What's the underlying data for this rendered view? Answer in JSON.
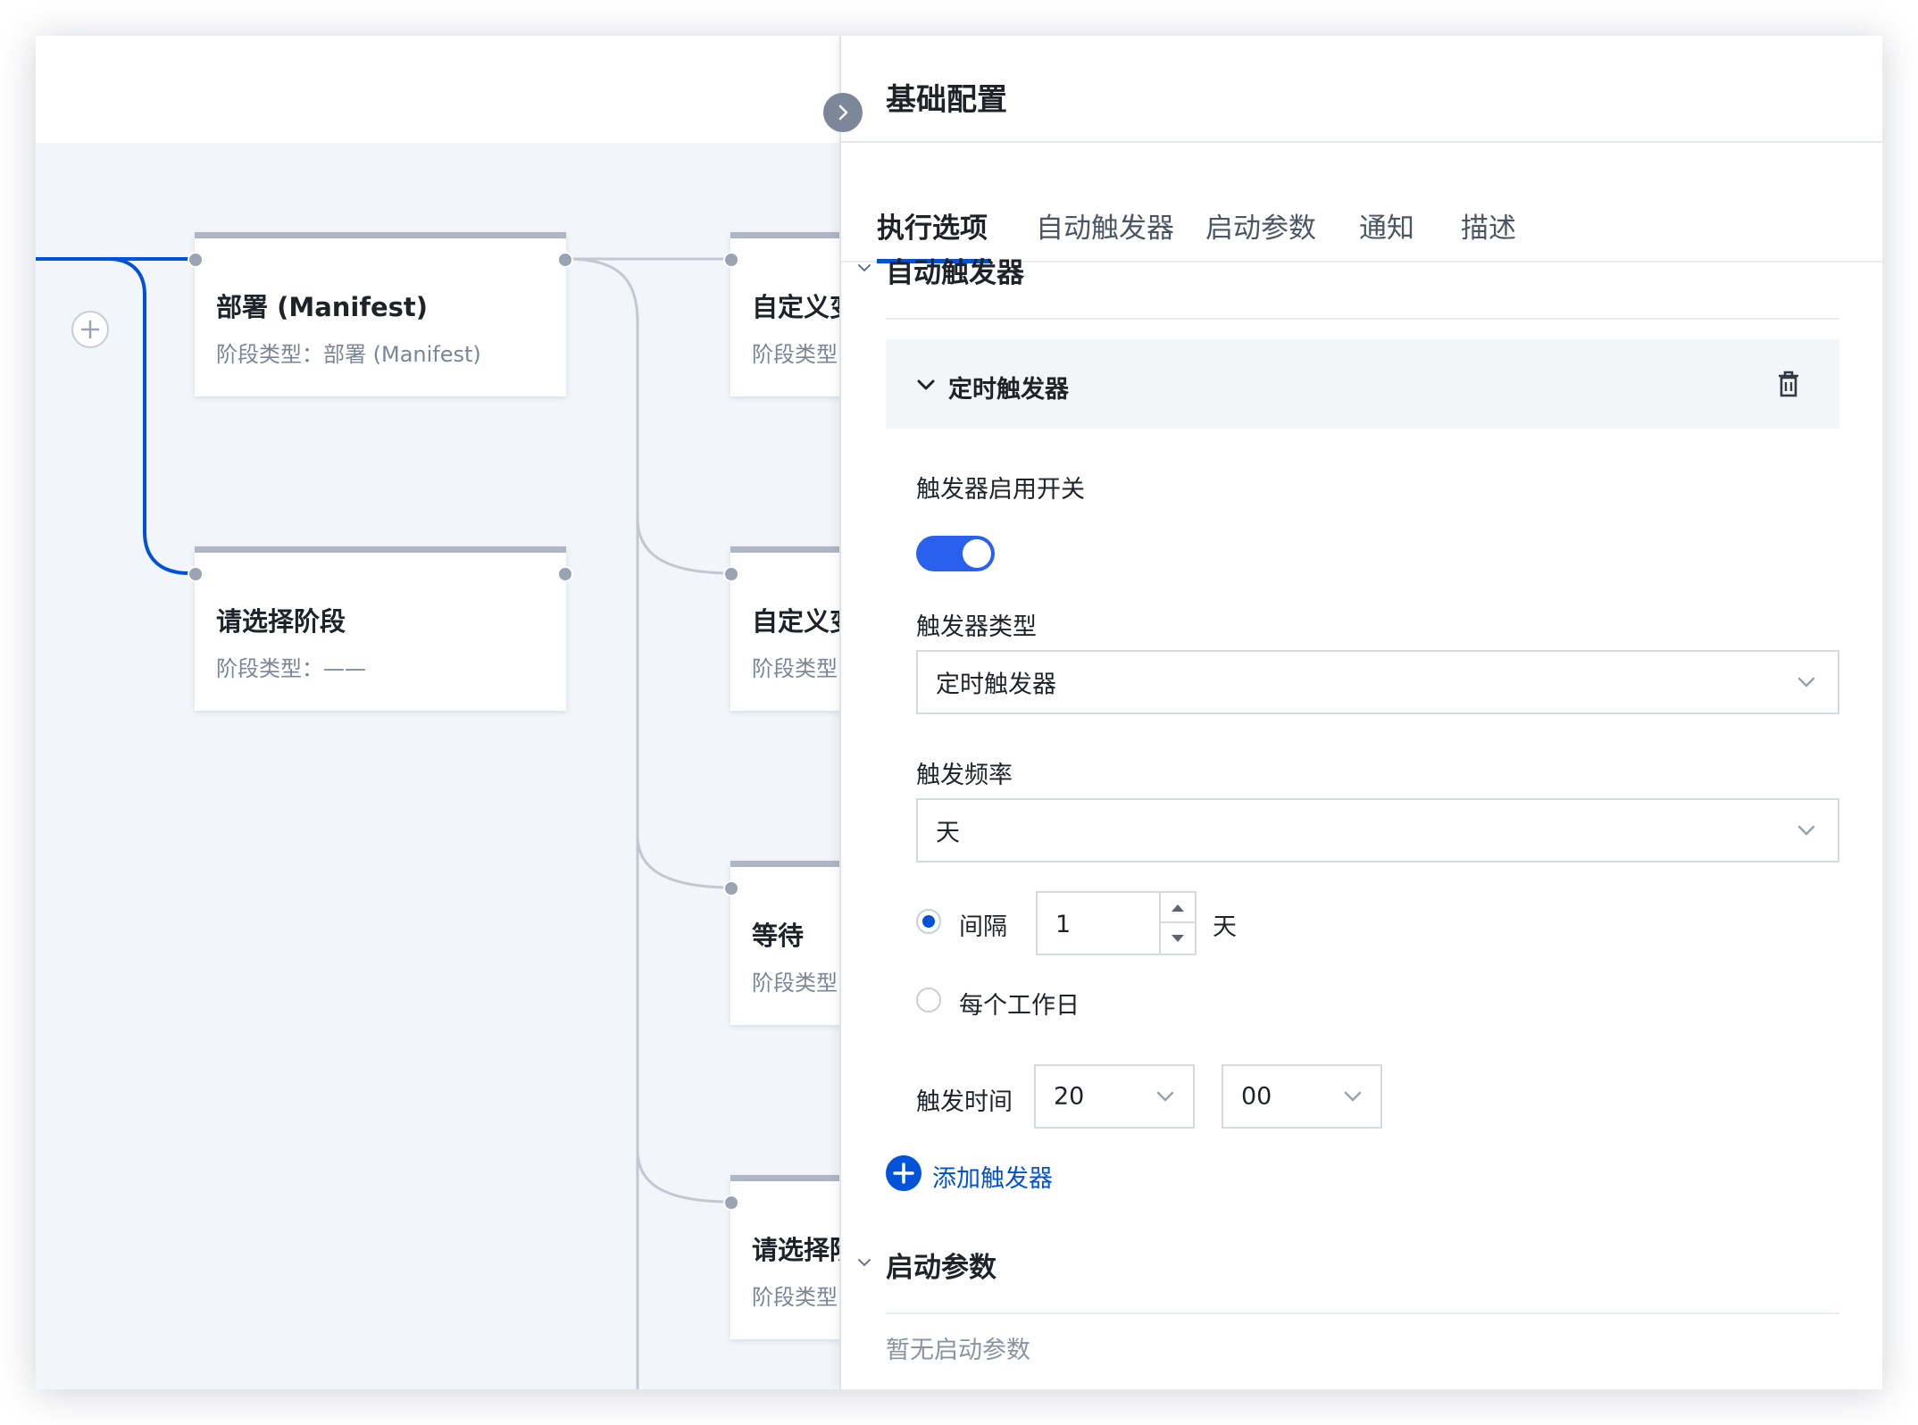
{
  "canvas": {
    "nodes": [
      {
        "title": "部署 (Manifest)",
        "type_label": "阶段类型：部署 (Manifest)"
      },
      {
        "title": "请选择阶段",
        "type_label": "阶段类型：——"
      },
      {
        "title": "自定义变",
        "type_label": "阶段类型"
      },
      {
        "title": "自定义变",
        "type_label": "阶段类型"
      },
      {
        "title": "等待",
        "type_label": "阶段类型"
      },
      {
        "title": "请选择阶",
        "type_label": "阶段类型"
      }
    ],
    "add_icon": "plus-icon",
    "accent_color": "#0052d9"
  },
  "panel": {
    "title": "基础配置",
    "collapse_icon": "chevron-right-icon",
    "tabs": [
      {
        "label": "执行选项",
        "active": true
      },
      {
        "label": "自动触发器",
        "active": false
      },
      {
        "label": "启动参数",
        "active": false
      },
      {
        "label": "通知",
        "active": false
      },
      {
        "label": "描述",
        "active": false
      }
    ],
    "sections": {
      "triggers": {
        "title": "自动触发器",
        "card": {
          "title": "定时触发器",
          "delete_icon": "trash-icon",
          "enable_label": "触发器启用开关",
          "enabled": true,
          "type_label": "触发器类型",
          "type_value": "定时触发器",
          "frequency_label": "触发频率",
          "frequency_value": "天",
          "interval_option": {
            "label": "间隔",
            "value": "1",
            "unit": "天",
            "checked": true
          },
          "workday_option": {
            "label": "每个工作日",
            "checked": false
          },
          "time_label": "触发时间",
          "hour_value": "20",
          "minute_value": "00"
        },
        "add_label": "添加触发器"
      },
      "params": {
        "title": "启动参数",
        "empty_text": "暂无启动参数"
      }
    }
  }
}
